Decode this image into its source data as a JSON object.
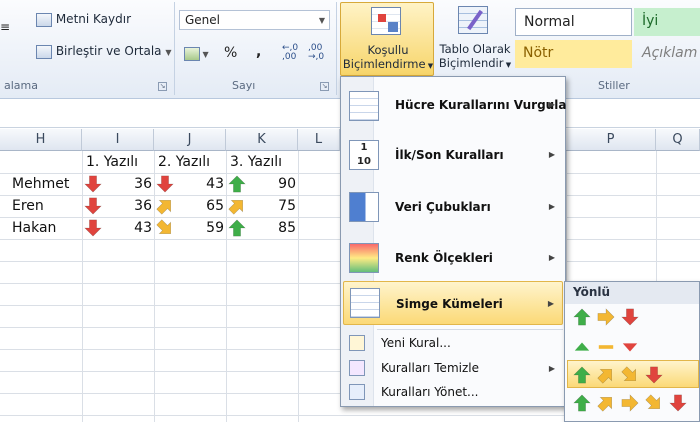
{
  "ribbon": {
    "alignment": {
      "wrap_text": "Metni Kaydır",
      "merge_center": "Birleştir ve Ortala",
      "group_label": "alama"
    },
    "number": {
      "format_value": "Genel",
      "percent": "%",
      "comma": ",",
      "group_label": "Sayı"
    },
    "styles": {
      "conditional_formatting": [
        "Koşullu",
        "Biçimlendirme"
      ],
      "format_as_table": [
        "Tablo Olarak",
        "Biçimlendir"
      ],
      "cell_styles": [
        "Normal",
        "İyi",
        "Nötr",
        "Açıklam"
      ],
      "group_label": "Stiller"
    }
  },
  "sheet": {
    "columns": [
      "H",
      "I",
      "J",
      "K",
      "L",
      "P",
      "Q"
    ],
    "headers": [
      "1. Yazılı",
      "2. Yazılı",
      "3. Yazılı"
    ],
    "rows": [
      {
        "name": "Mehmet",
        "v1": "36",
        "v2": "43",
        "v3": "90",
        "i1": "down-red",
        "i2": "down-red",
        "i3": "up-green"
      },
      {
        "name": "Eren",
        "v1": "36",
        "v2": "65",
        "v3": "75",
        "i1": "down-red",
        "i2": "up-right-orange",
        "i3": "up-right-orange"
      },
      {
        "name": "Hakan",
        "v1": "43",
        "v2": "59",
        "v3": "85",
        "i1": "down-red",
        "i2": "down-right-orange",
        "i3": "up-green"
      }
    ]
  },
  "menu": {
    "items": [
      {
        "label": "Hücre Kurallarını Vurgula",
        "has_submenu": true
      },
      {
        "label": "İlk/Son Kuralları",
        "has_submenu": true
      },
      {
        "label": "Veri Çubukları",
        "has_submenu": true
      },
      {
        "label": "Renk Ölçekleri",
        "has_submenu": true
      },
      {
        "label": "Simge Kümeleri",
        "has_submenu": true,
        "highlighted": true
      }
    ],
    "small_items": [
      {
        "label": "Yeni Kural..."
      },
      {
        "label": "Kuralları Temizle",
        "has_submenu": true
      },
      {
        "label": "Kuralları Yönet..."
      }
    ]
  },
  "submenu": {
    "title": "Yönlü",
    "rows": [
      [
        "up-green",
        "right-orange",
        "down-red"
      ],
      [
        "tri-up-green",
        "dash-orange",
        "tri-down-red"
      ],
      [
        "up-green",
        "up-right-orange",
        "down-right-orange",
        "down-red"
      ],
      [
        "up-green",
        "up-right-orange",
        "right-orange",
        "down-right-orange",
        "down-red"
      ]
    ]
  },
  "colors": {
    "accent_orange": "#f5c050",
    "arrow_green": "#3fae49",
    "arrow_red": "#e0443e",
    "arrow_orange": "#f3b732",
    "selection": "#fde9a0"
  }
}
